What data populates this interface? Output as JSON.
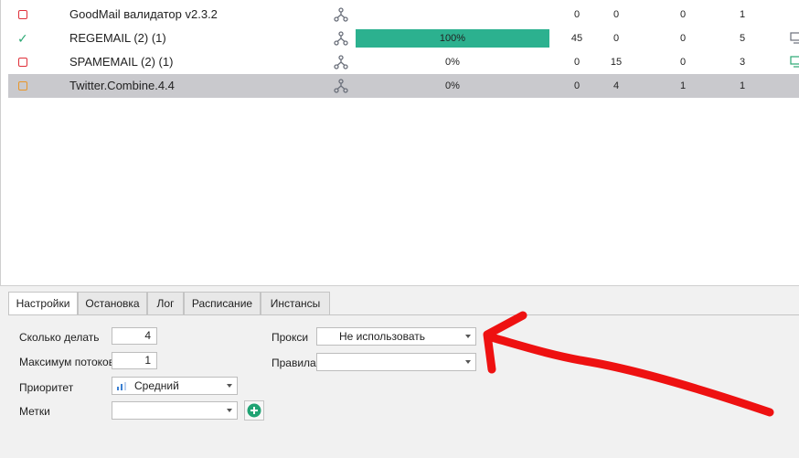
{
  "tasks": [
    {
      "status": "stopped",
      "name": "GoodMail валидатор v2.3.2",
      "progress": null,
      "progress_text": "",
      "c1": "0",
      "c2": "0",
      "c3": "0",
      "c4": "1",
      "monitor": false,
      "selected": false
    },
    {
      "status": "done",
      "name": "REGEMAIL (2) (1)",
      "progress": 1.0,
      "progress_text": "100%",
      "c1": "45",
      "c2": "0",
      "c3": "0",
      "c4": "5",
      "monitor": true,
      "selected": false
    },
    {
      "status": "stopped",
      "name": "SPAMEMAIL (2) (1)",
      "progress": 0,
      "progress_text": "0%",
      "c1": "0",
      "c2": "15",
      "c3": "0",
      "c4": "3",
      "monitor": true,
      "selected": false
    },
    {
      "status": "paused",
      "name": "Twitter.Combine.4.4",
      "progress": 0,
      "progress_text": "0%",
      "c1": "0",
      "c2": "4",
      "c3": "1",
      "c4": "1",
      "monitor": false,
      "selected": true
    }
  ],
  "colors": {
    "stopped": "#e0303a",
    "done": "#2aa873",
    "paused": "#e8962a",
    "progress": "#2cb18f",
    "annotation_arrow": "#ee1111"
  },
  "tabs": [
    {
      "label": "Настройки",
      "active": true
    },
    {
      "label": "Остановка",
      "active": false
    },
    {
      "label": "Лог",
      "active": false
    },
    {
      "label": "Расписание",
      "active": false
    },
    {
      "label": "Инстансы",
      "active": false
    }
  ],
  "settings": {
    "count_label": "Сколько делать",
    "count_value": "4",
    "threads_label": "Максимум потоков",
    "threads_value": "1",
    "priority_label": "Приоритет",
    "priority_value": "Средний",
    "tags_label": "Метки",
    "tags_value": "",
    "proxy_label": "Прокси",
    "proxy_value": "Не использовать",
    "rules_label": "Правила",
    "rules_value": ""
  }
}
